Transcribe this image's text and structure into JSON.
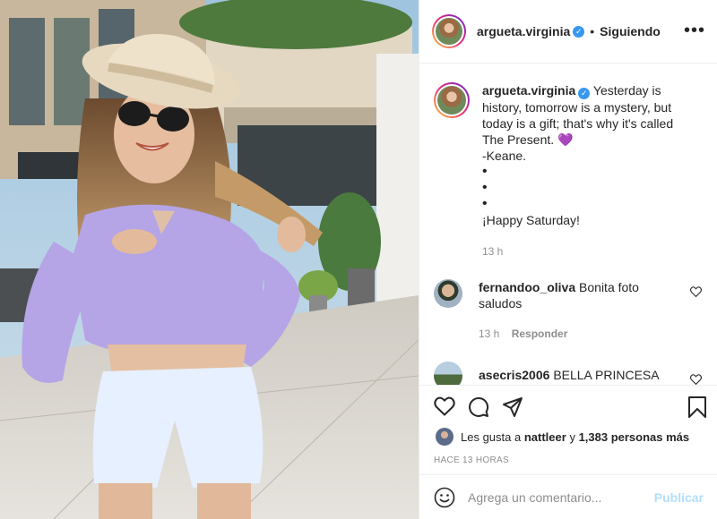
{
  "header": {
    "username": "argueta.virginia",
    "separator": "•",
    "follow_state": "Siguiendo",
    "more_label": "•••"
  },
  "caption": {
    "username": "argueta.virginia",
    "text_first": "Yesterday is history, tomorrow is a mystery, but today is a gift; that's why it's called The Present.",
    "emoji": "💜",
    "lines": [
      "-Keane.",
      "•",
      "•",
      "•",
      "¡Happy Saturday!"
    ],
    "time": "13 h"
  },
  "comments": [
    {
      "username": "fernandoo_oliva",
      "text": "Bonita foto saludos",
      "time": "13 h",
      "reply_label": "Responder"
    },
    {
      "username": "asecris2006",
      "text": "BELLA PRINCESA"
    }
  ],
  "actions": {
    "icons": [
      "heart-icon",
      "comment-icon",
      "share-icon",
      "bookmark-icon"
    ]
  },
  "likes": {
    "prefix": "Les gusta a",
    "user": "nattleer",
    "connector": "y",
    "others": "1,383 personas más"
  },
  "posted_ago": "HACE 13 HORAS",
  "add_comment": {
    "placeholder": "Agrega un comentario...",
    "publish_label": "Publicar"
  },
  "colors": {
    "verified": "#3897f0",
    "publish_disabled": "#b2dffc",
    "muted": "#8e8e8e",
    "shirt": "#b5a4e6"
  }
}
